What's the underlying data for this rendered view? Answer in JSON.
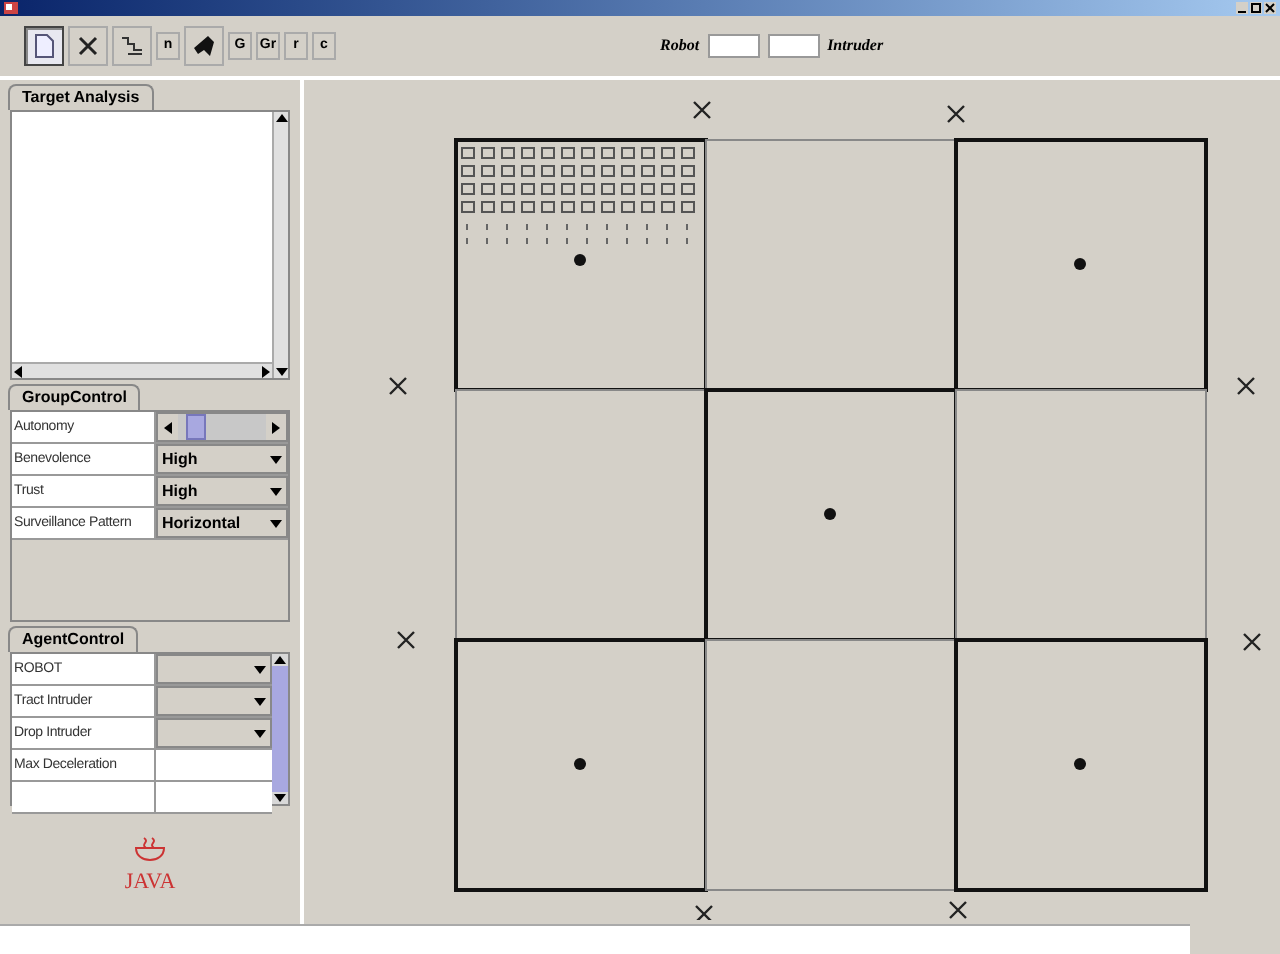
{
  "toolbar": {
    "buttons": [
      {
        "kind": "document",
        "selected": true
      },
      {
        "kind": "cross",
        "selected": false
      },
      {
        "kind": "stairs",
        "selected": false
      },
      {
        "kind": "text",
        "label": "n",
        "selected": false
      },
      {
        "kind": "shape",
        "selected": false
      },
      {
        "kind": "text",
        "label": "G",
        "selected": false
      },
      {
        "kind": "text",
        "label": "Gr",
        "selected": false
      },
      {
        "kind": "text",
        "label": "r",
        "selected": false
      },
      {
        "kind": "text",
        "label": "c",
        "selected": false
      }
    ],
    "robot_label": "Robot",
    "intruder_label": "Intruder"
  },
  "target_analysis": {
    "tab": "Target Analysis"
  },
  "group_control": {
    "tab": "GroupControl",
    "rows": [
      {
        "kind": "slider",
        "label": "Autonomy",
        "level": 0.08
      },
      {
        "kind": "select",
        "label": "Benevolence",
        "value": "High"
      },
      {
        "kind": "select",
        "label": "Trust",
        "value": "High"
      },
      {
        "kind": "select",
        "label": "Surveillance Pattern",
        "value": "Horizontal"
      }
    ]
  },
  "agent_control": {
    "tab": "AgentControl",
    "rows": [
      {
        "kind": "select",
        "label": "ROBOT"
      },
      {
        "kind": "select",
        "label": "Tract Intruder"
      },
      {
        "kind": "select",
        "label": "Drop Intruder"
      },
      {
        "kind": "field",
        "label": "Max Deceleration"
      },
      {
        "kind": "field"
      }
    ]
  },
  "logo": {
    "text": "JAVA"
  },
  "grid": {
    "cells": [
      {
        "agent": true,
        "trail": true
      },
      {
        "agent": false,
        "trail": false
      },
      {
        "agent": true,
        "trail": false
      },
      {
        "agent": false,
        "trail": false
      },
      {
        "agent": true,
        "trail": false
      },
      {
        "agent": false,
        "trail": false
      },
      {
        "agent": true,
        "trail": false
      },
      {
        "agent": false,
        "trail": false
      },
      {
        "agent": true,
        "trail": false
      }
    ]
  }
}
